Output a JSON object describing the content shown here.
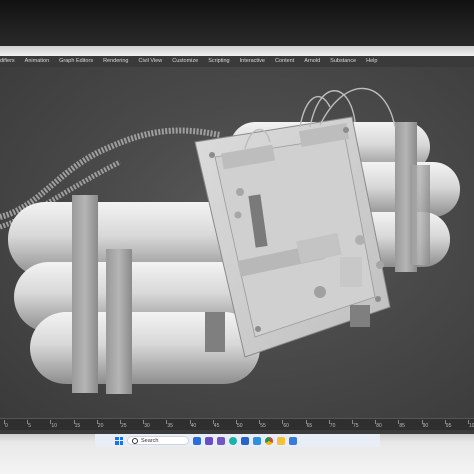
{
  "menu": {
    "items": [
      "difiers",
      "Animation",
      "Graph Editors",
      "Rendering",
      "Civil View",
      "Customize",
      "Scripting",
      "Interactive",
      "Content",
      "Arnold",
      "Substance",
      "Help"
    ]
  },
  "timeline": {
    "ticks": [
      "0",
      "5",
      "10",
      "15",
      "20",
      "25",
      "30",
      "35",
      "40",
      "45",
      "50",
      "55",
      "60",
      "65",
      "70",
      "75",
      "80",
      "85",
      "90",
      "95",
      "100"
    ]
  },
  "taskbar": {
    "search_label": "Search",
    "icons": [
      "windows-icon",
      "search-icon",
      "tasks-icon",
      "video-icon",
      "chat-icon",
      "edge-icon",
      "store-icon",
      "photos-icon",
      "chrome-icon",
      "explorer-icon",
      "app-icon"
    ]
  },
  "colors": {
    "menubar_bg": "#3a3a3a",
    "viewport_bg": "#4a4a4a",
    "model_gray": "#d7d7d7",
    "accent_blue": "#1a73e8"
  }
}
